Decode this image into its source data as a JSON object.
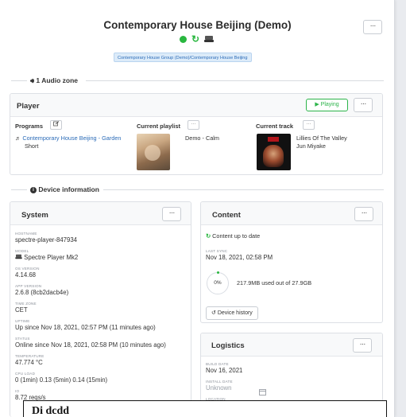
{
  "header": {
    "title": "Contemporary House Beijing (Demo)",
    "group_tag": "Contemporary House Group (Demo)/Contemporary House Beijing",
    "more_label": "···"
  },
  "audio_zone": {
    "label": "1 Audio zone"
  },
  "player": {
    "title": "Player",
    "playing_label": "Playing",
    "programs_label": "Programs",
    "program_name_line1": "Contemporary House Beijing - Garden",
    "program_name_line2": "Short",
    "current_playlist_label": "Current playlist",
    "playlist_name": "Demo - Calm",
    "current_track_label": "Current track",
    "track_title": "Lillies Of The Valley",
    "track_artist": "Jun Miyake"
  },
  "device_info": {
    "label": "Device information"
  },
  "system": {
    "title": "System",
    "fields": [
      {
        "label": "Hostname",
        "value": "spectre-player-847934"
      },
      {
        "label": "Model",
        "value": "Spectre Player Mk2"
      },
      {
        "label": "OS version",
        "value": "4.14.68"
      },
      {
        "label": "App version",
        "value": "2.6.8 (8cb2dacb4e)"
      },
      {
        "label": "Time zone",
        "value": "CET"
      },
      {
        "label": "Uptime",
        "value": "Up since Nov 18, 2021, 02:57 PM (11 minutes ago)"
      },
      {
        "label": "Status",
        "value": "Online since Nov 18, 2021, 02:58 PM (10 minutes ago)"
      },
      {
        "label": "Temperature",
        "value": "47.774 °C"
      },
      {
        "label": "CPU load",
        "value": "0 (1min) 0.13 (5min) 0.14 (15min)"
      },
      {
        "label": "IO",
        "value": "8.72 reqs/s"
      }
    ]
  },
  "content": {
    "title": "Content",
    "status": "Content up to date",
    "last_sync_label": "Last sync",
    "last_sync_value": "Nov 18, 2021, 02:58 PM",
    "usage_percent": "0%",
    "usage_text": "217.9MB used out of 27.9GB",
    "history_button": "Device history"
  },
  "logistics": {
    "title": "Logistics",
    "build_date_label": "Build date",
    "build_date_value": "Nov 16, 2021",
    "install_date_label": "Install date",
    "install_date_value": "Unknown",
    "location_label": "Location"
  },
  "tooltip": {
    "text": "Di dcdd"
  },
  "colors": {
    "accent_green": "#29b73f",
    "link_blue": "#2c6cb8"
  }
}
